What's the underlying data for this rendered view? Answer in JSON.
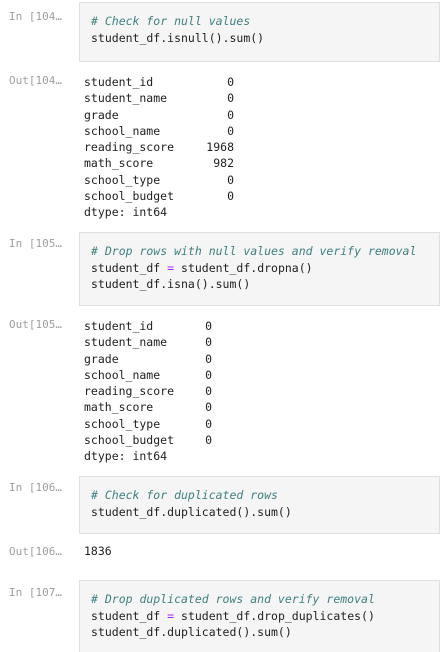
{
  "cells": [
    {
      "in_prompt": "In [104…",
      "code": [
        {
          "comment": "# Check for null values"
        },
        {
          "a": "student_df.isnull().sum()"
        }
      ],
      "out_prompt": "Out[104…",
      "output": [
        {
          "k": "student_id",
          "v": "0"
        },
        {
          "k": "student_name",
          "v": "0"
        },
        {
          "k": "grade",
          "v": "0"
        },
        {
          "k": "school_name",
          "v": "0"
        },
        {
          "k": "reading_score",
          "v": "1968"
        },
        {
          "k": "math_score",
          "v": "982"
        },
        {
          "k": "school_type",
          "v": "0"
        },
        {
          "k": "school_budget",
          "v": "0"
        },
        {
          "k": "dtype: int64",
          "v": ""
        }
      ]
    },
    {
      "in_prompt": "In [105…",
      "code": [
        {
          "comment": "# Drop rows with null values and verify removal"
        },
        {
          "a": "student_df ",
          "op": "=",
          "b": " student_df.dropna()"
        },
        {
          "a": "student_df.isna().sum()"
        }
      ],
      "out_prompt": "Out[105…",
      "output": [
        {
          "k": "student_id",
          "v": "0"
        },
        {
          "k": "student_name",
          "v": "0"
        },
        {
          "k": "grade",
          "v": "0"
        },
        {
          "k": "school_name",
          "v": "0"
        },
        {
          "k": "reading_score",
          "v": "0"
        },
        {
          "k": "math_score",
          "v": "0"
        },
        {
          "k": "school_type",
          "v": "0"
        },
        {
          "k": "school_budget",
          "v": "0"
        },
        {
          "k": "dtype: int64",
          "v": ""
        }
      ]
    },
    {
      "in_prompt": "In [106…",
      "code": [
        {
          "comment": "# Check for duplicated rows"
        },
        {
          "a": "student_df.duplicated().sum()"
        }
      ],
      "out_prompt": "Out[106…",
      "output_single": "1836"
    },
    {
      "in_prompt": "In [107…",
      "code": [
        {
          "comment": "# Drop duplicated rows and verify removal"
        },
        {
          "a": "student_df ",
          "op": "=",
          "b": " student_df.drop_duplicates()"
        },
        {
          "a": "student_df.duplicated().sum()"
        }
      ]
    }
  ]
}
